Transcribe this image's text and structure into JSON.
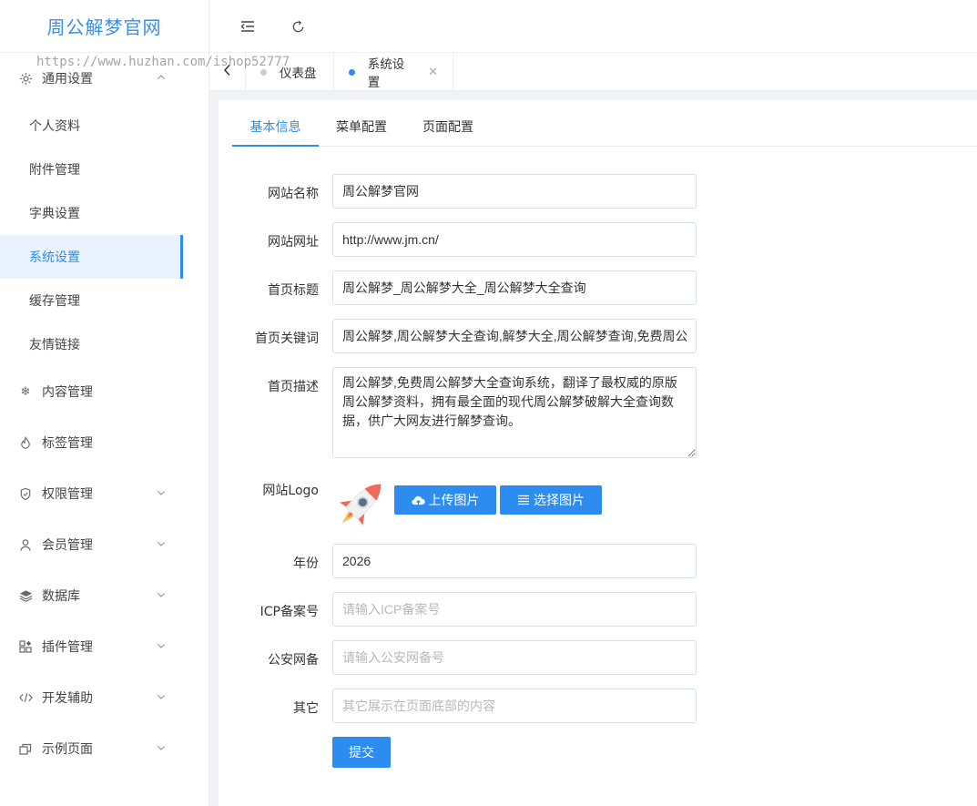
{
  "app": {
    "title": "周公解梦官网"
  },
  "watermark": "https://www.huzhan.com/ishop52777",
  "sidebar": {
    "group_general": {
      "label": "通用设置",
      "icon": "gear-icon"
    },
    "sub_items": [
      {
        "label": "个人资料"
      },
      {
        "label": "附件管理"
      },
      {
        "label": "字典设置"
      },
      {
        "label": "系统设置"
      },
      {
        "label": "缓存管理"
      },
      {
        "label": "友情链接"
      }
    ],
    "groups": [
      {
        "label": "内容管理",
        "icon": "snowflake-icon"
      },
      {
        "label": "标签管理",
        "icon": "fire-icon"
      },
      {
        "label": "权限管理",
        "icon": "shield-icon"
      },
      {
        "label": "会员管理",
        "icon": "user-icon"
      },
      {
        "label": "数据库",
        "icon": "layers-icon"
      },
      {
        "label": "插件管理",
        "icon": "apps-icon"
      },
      {
        "label": "开发辅助",
        "icon": "code-icon"
      },
      {
        "label": "示例页面",
        "icon": "copy-icon"
      }
    ]
  },
  "tabs": [
    {
      "label": "仪表盘"
    },
    {
      "label": "系统设置"
    }
  ],
  "subtabs": [
    {
      "label": "基本信息"
    },
    {
      "label": "菜单配置"
    },
    {
      "label": "页面配置"
    }
  ],
  "form": {
    "site_name": {
      "label": "网站名称",
      "value": "周公解梦官网"
    },
    "site_url": {
      "label": "网站网址",
      "value": "http://www.jm.cn/"
    },
    "home_title": {
      "label": "首页标题",
      "value": "周公解梦_周公解梦大全_周公解梦大全查询"
    },
    "home_keywords": {
      "label": "首页关键词",
      "value": "周公解梦,周公解梦大全查询,解梦大全,周公解梦查询,免费周公解梦"
    },
    "home_desc": {
      "label": "首页描述",
      "value": "周公解梦,免费周公解梦大全查询系统，翻译了最权威的原版周公解梦资料，拥有最全面的现代周公解梦破解大全查询数据，供广大网友进行解梦查询。"
    },
    "logo": {
      "label": "网站Logo",
      "upload_label": "上传图片",
      "choose_label": "选择图片"
    },
    "year": {
      "label": "年份",
      "value": "2026"
    },
    "icp": {
      "label": "ICP备案号",
      "placeholder": "请输入ICP备案号"
    },
    "police": {
      "label": "公安网备",
      "placeholder": "请输入公安网备号"
    },
    "other": {
      "label": "其它",
      "placeholder": "其它展示在页面底部的内容"
    },
    "submit_label": "提交"
  }
}
